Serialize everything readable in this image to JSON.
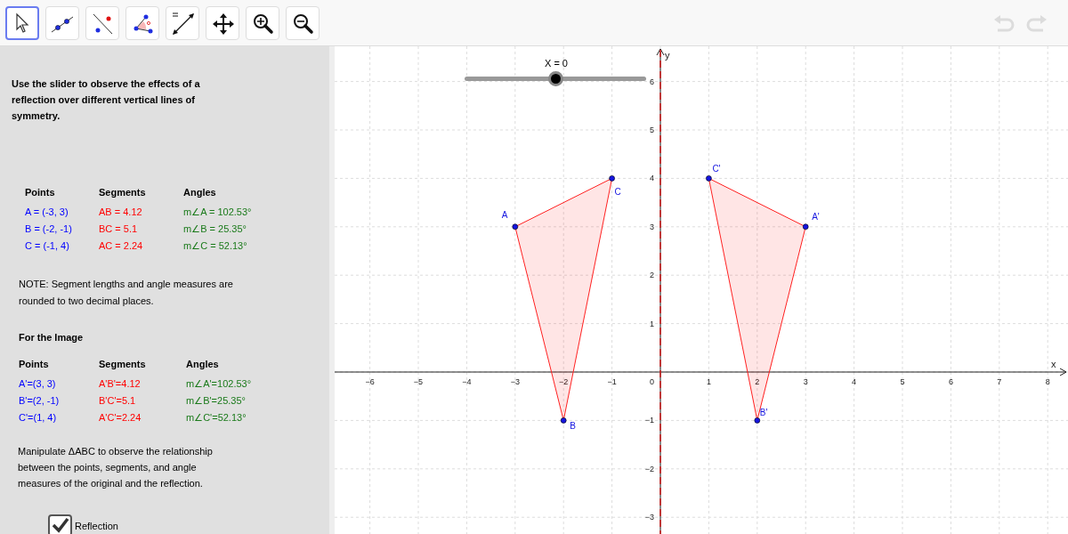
{
  "toolbar": {
    "tools": [
      {
        "selected": true
      },
      {
        "selected": false
      },
      {
        "selected": false
      },
      {
        "selected": false
      },
      {
        "selected": false
      },
      {
        "selected": false
      },
      {
        "selected": false
      },
      {
        "selected": false
      }
    ],
    "undo": {
      "disabled": true
    },
    "redo": {
      "disabled": true
    }
  },
  "panel": {
    "instruction": "Use the slider to observe the effects of a reflection over different vertical lines of symmetry.",
    "original_table": {
      "columns": [
        "Points",
        "Segments",
        "Angles"
      ],
      "rows": [
        [
          "A = (-3, 3)",
          "AB = 4.12",
          "m∠A = 102.53°"
        ],
        [
          "B = (-2, -1)",
          "BC = 5.1",
          "m∠B = 25.35°"
        ],
        [
          "C = (-1, 4)",
          "AC = 2.24",
          "m∠C = 52.13°"
        ]
      ]
    },
    "note": "NOTE: Segment lengths and angle measures are rounded to two decimal places.",
    "image_heading": "For the Image",
    "image_table": {
      "columns": [
        "Points",
        "Segments",
        "Angles"
      ],
      "rows": [
        [
          "A'=(3, 3)",
          "A'B'=4.12",
          "m∠A'=102.53°"
        ],
        [
          "B'=(2, -1)",
          "B'C'=5.1",
          "m∠B'=25.35°"
        ],
        [
          "C'=(1, 4)",
          "A'C'=2.24",
          "m∠C'=52.13°"
        ]
      ]
    },
    "manipulate": "Manipulate ΔABC to observe the relationship between the points, segments, and angle measures of the original and the reflection.",
    "checkbox": {
      "label": "Reflection",
      "checked": true
    }
  },
  "graph": {
    "slider": {
      "label": "X = 0",
      "level": 0.5
    },
    "x_axis": {
      "label": "x",
      "ticks": [
        "−6",
        "−5",
        "−4",
        "−3",
        "−2",
        "−1",
        "1",
        "2",
        "3",
        "4",
        "5",
        "6",
        "7",
        "8"
      ]
    },
    "y_axis": {
      "label": "y",
      "ticks": [
        "6",
        "5",
        "4",
        "3",
        "2",
        "1",
        "−1",
        "−2",
        "−3"
      ]
    },
    "origin_label": "0",
    "point_labels": [
      "A",
      "B",
      "C",
      "A'",
      "B'",
      "C'"
    ]
  }
}
